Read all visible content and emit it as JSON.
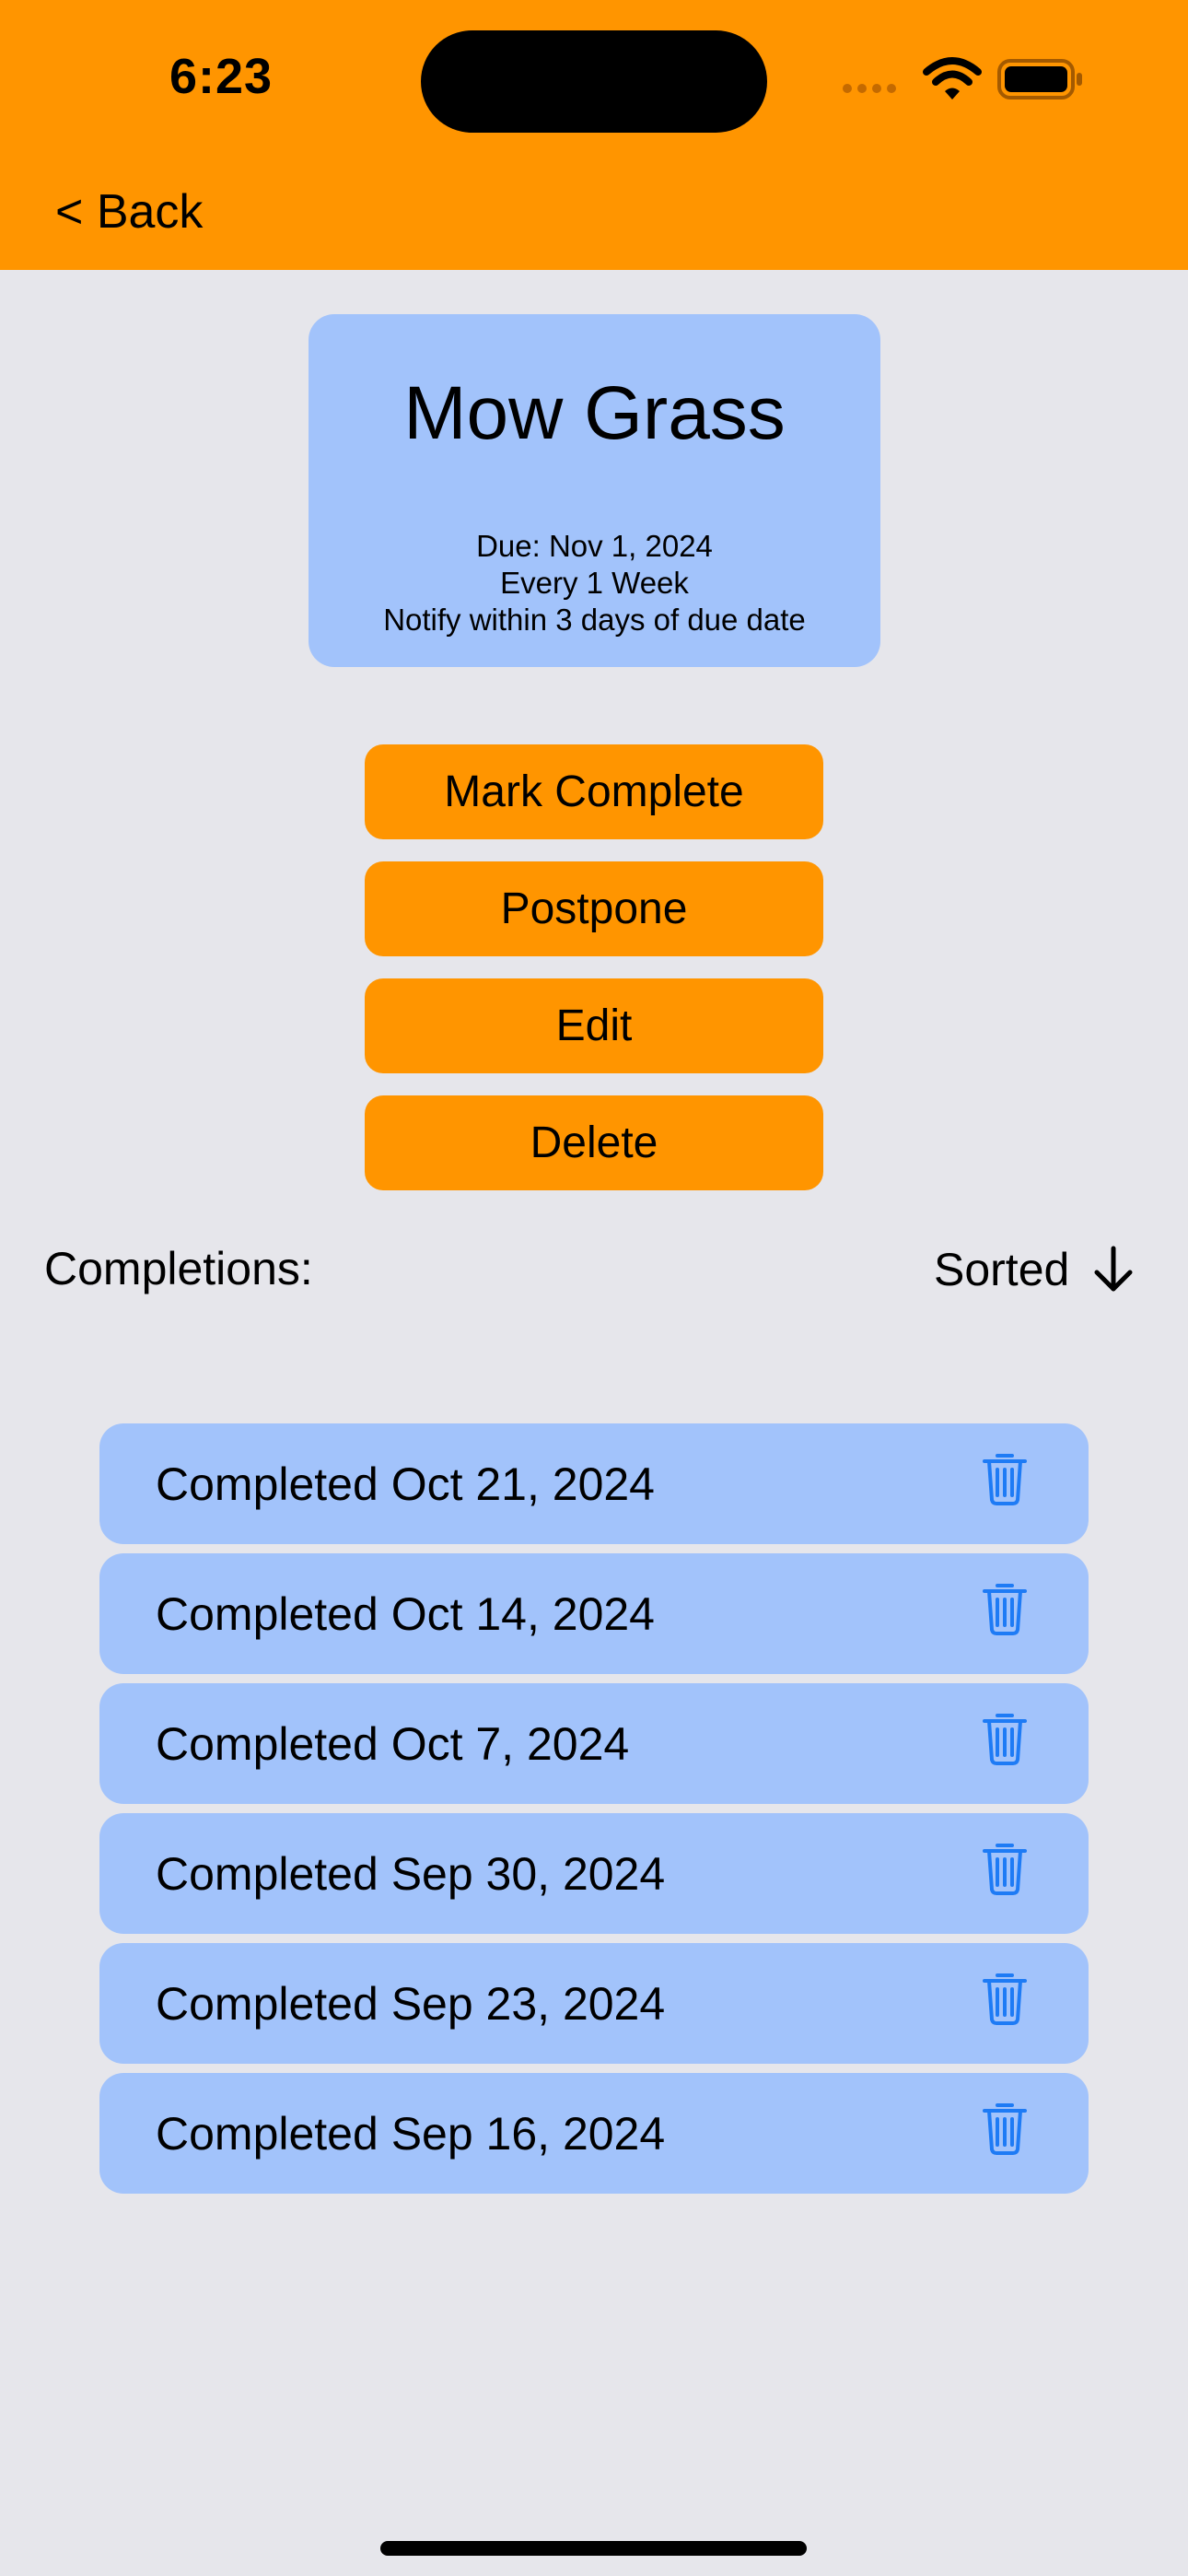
{
  "status_bar": {
    "time": "6:23"
  },
  "nav": {
    "back_label": "< Back"
  },
  "task": {
    "title": "Mow Grass",
    "due": "Due: Nov 1, 2024",
    "frequency": "Every 1 Week",
    "notify": "Notify within 3 days of due date"
  },
  "actions": {
    "mark_complete": "Mark Complete",
    "postpone": "Postpone",
    "edit": "Edit",
    "delete": "Delete"
  },
  "completions": {
    "label": "Completions:",
    "sort_label": "Sorted",
    "sort_icon": "arrow-down-icon",
    "items": [
      {
        "label": "Completed Oct 21, 2024",
        "icon": "trash-icon"
      },
      {
        "label": "Completed Oct 14, 2024",
        "icon": "trash-icon"
      },
      {
        "label": "Completed Oct 7, 2024",
        "icon": "trash-icon"
      },
      {
        "label": "Completed Sep 30, 2024",
        "icon": "trash-icon"
      },
      {
        "label": "Completed Sep 23, 2024",
        "icon": "trash-icon"
      },
      {
        "label": "Completed Sep 16, 2024",
        "icon": "trash-icon"
      }
    ]
  },
  "colors": {
    "accent": "#FF9500",
    "card": "#A2C3FB",
    "background": "#E6E6EB",
    "icon_blue": "#1E7BF5"
  }
}
